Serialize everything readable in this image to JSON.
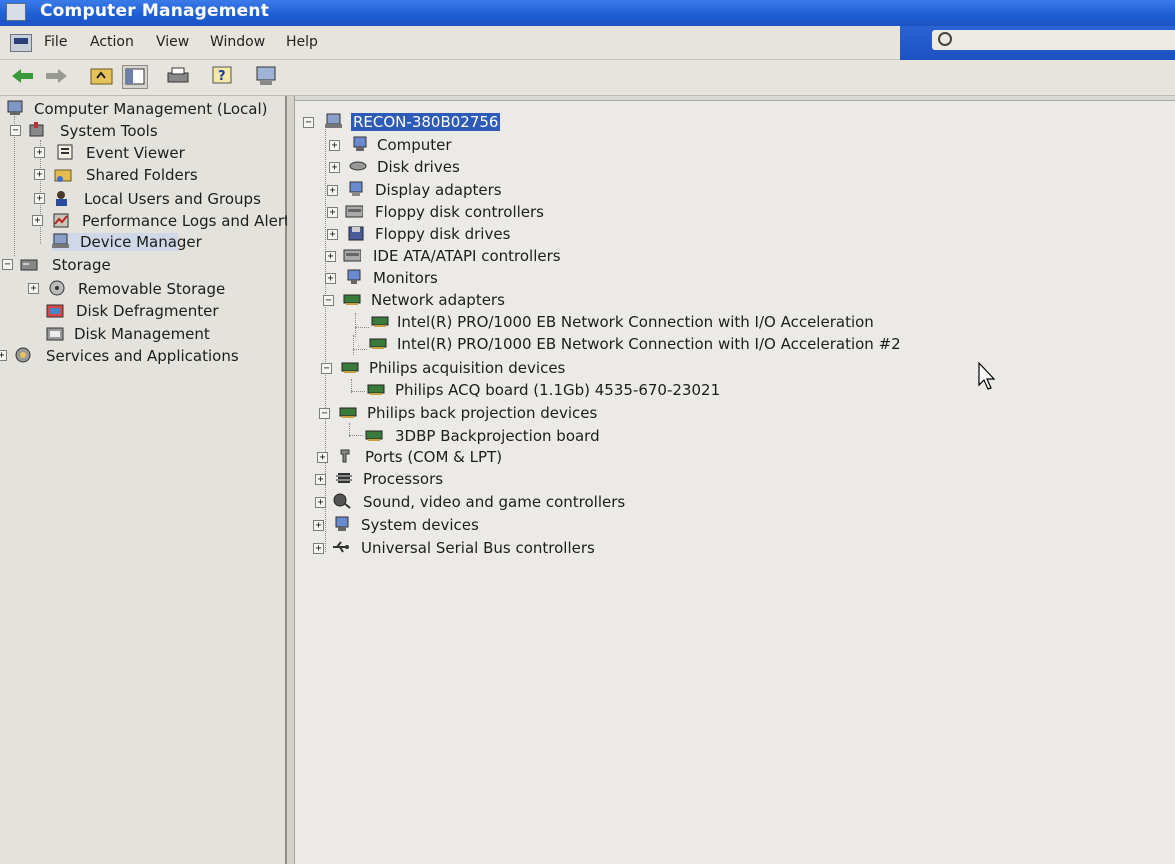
{
  "window": {
    "title": "Computer Management"
  },
  "menu": [
    "File",
    "Action",
    "View",
    "Window",
    "Help"
  ],
  "toolbar": {
    "icons": [
      "back-arrow-icon",
      "forward-arrow-icon",
      "up-folder-icon",
      "show-hide-tree-icon",
      "print-icon",
      "help-icon",
      "computer-properties-icon"
    ]
  },
  "left_tree": {
    "root": "Computer Management (Local)",
    "system_tools": "System Tools",
    "event_viewer": "Event Viewer",
    "shared_folders": "Shared Folders",
    "local_users": "Local Users and Groups",
    "perf_logs": "Performance Logs and Alerts",
    "device_manager": "Device Manager",
    "storage": "Storage",
    "removable_storage": "Removable Storage",
    "disk_defrag": "Disk Defragmenter",
    "disk_management": "Disk Management",
    "services_apps": "Services and Applications"
  },
  "device_tree": {
    "root": "RECON-380B02756",
    "computer": "Computer",
    "disk_drives": "Disk drives",
    "display_adapters": "Display adapters",
    "floppy_controllers": "Floppy disk controllers",
    "floppy_drives": "Floppy disk drives",
    "ide": "IDE ATA/ATAPI controllers",
    "monitors": "Monitors",
    "network_adapters": "Network adapters",
    "nic1": "Intel(R) PRO/1000 EB Network Connection with I/O Acceleration",
    "nic2": "Intel(R) PRO/1000 EB Network Connection with I/O Acceleration #2",
    "philips_acq": "Philips acquisition devices",
    "acq_board": "Philips ACQ board (1.1Gb) 4535-670-23021",
    "philips_bp": "Philips back projection devices",
    "bp_board": "3DBP Backprojection board",
    "ports": "Ports (COM & LPT)",
    "processors": "Processors",
    "sound": "Sound, video and game controllers",
    "system_devices": "System devices",
    "usb": "Universal Serial Bus controllers"
  },
  "colors": {
    "titlebar": "#1f5fd6",
    "selection": "#2f5bb8",
    "pane_bg": "#ebeae6"
  }
}
